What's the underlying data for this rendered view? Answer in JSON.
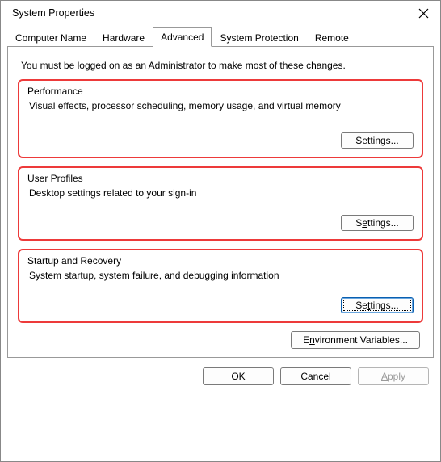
{
  "window": {
    "title": "System Properties"
  },
  "tabs": {
    "computerName": "Computer Name",
    "hardware": "Hardware",
    "advanced": "Advanced",
    "systemProtection": "System Protection",
    "remote": "Remote"
  },
  "intro": "You must be logged on as an Administrator to make most of these changes.",
  "groups": {
    "performance": {
      "title": "Performance",
      "desc": "Visual effects, processor scheduling, memory usage, and virtual memory",
      "button_pre": "S",
      "button_u": "e",
      "button_post": "ttings..."
    },
    "userProfiles": {
      "title": "User Profiles",
      "desc": "Desktop settings related to your sign-in",
      "button_pre": "S",
      "button_u": "e",
      "button_post": "ttings..."
    },
    "startupRecovery": {
      "title": "Startup and Recovery",
      "desc": "System startup, system failure, and debugging information",
      "button_pre": "Se",
      "button_u": "t",
      "button_post": "tings..."
    }
  },
  "envVars": {
    "label_pre": "E",
    "label_u": "n",
    "label_post": "vironment Variables..."
  },
  "buttons": {
    "ok": "OK",
    "cancel": "Cancel",
    "apply_pre": "",
    "apply_u": "A",
    "apply_post": "pply"
  }
}
